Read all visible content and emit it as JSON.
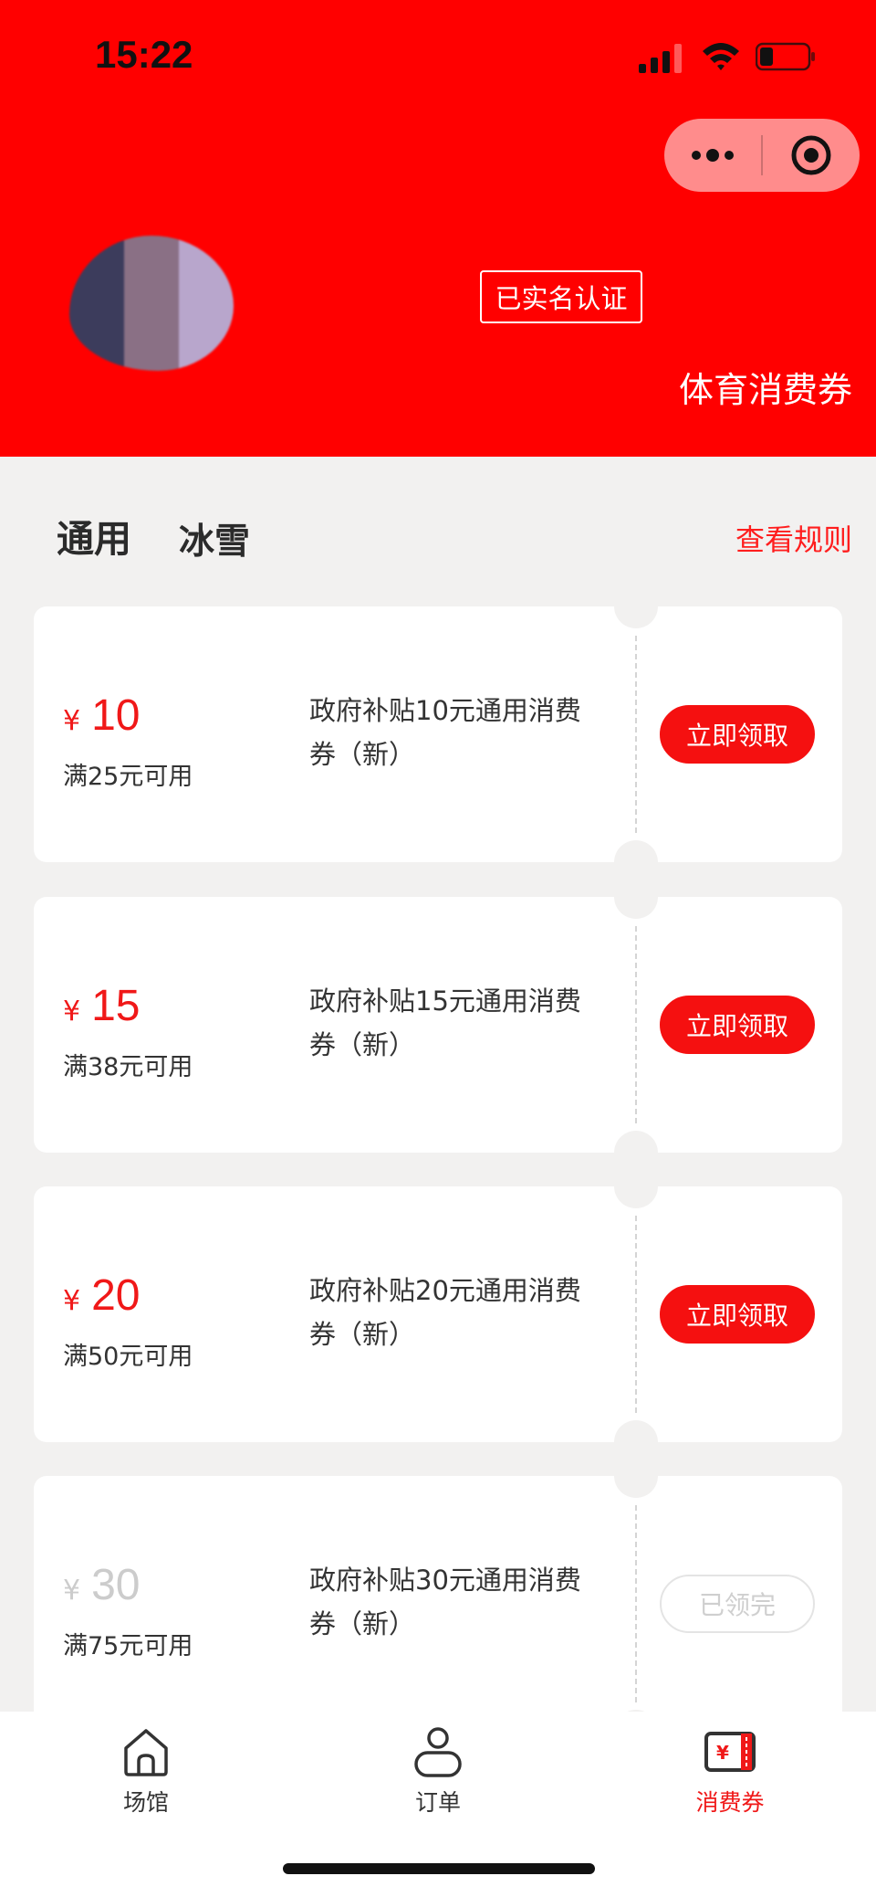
{
  "status_bar": {
    "time": "15:22"
  },
  "header": {
    "verified_label": "已实名认证",
    "title": "体育消费券",
    "brand_color": "#ff0000"
  },
  "tabs": [
    {
      "label": "通用",
      "active": true
    },
    {
      "label": "冰雪",
      "active": false
    }
  ],
  "rules_link": "查看规则",
  "coupons": [
    {
      "currency": "¥",
      "amount": "10",
      "threshold": "满25元可用",
      "desc": "政府补贴10元通用消费券（新）",
      "action": "立即领取",
      "available": true
    },
    {
      "currency": "¥",
      "amount": "15",
      "threshold": "满38元可用",
      "desc": "政府补贴15元通用消费券（新）",
      "action": "立即领取",
      "available": true
    },
    {
      "currency": "¥",
      "amount": "20",
      "threshold": "满50元可用",
      "desc": "政府补贴20元通用消费券（新）",
      "action": "立即领取",
      "available": true
    },
    {
      "currency": "¥",
      "amount": "30",
      "threshold": "满75元可用",
      "desc": "政府补贴30元通用消费券（新）",
      "action": "已领完",
      "available": false
    }
  ],
  "bottom_nav": [
    {
      "label": "场馆",
      "icon": "home-icon",
      "active": false
    },
    {
      "label": "订单",
      "icon": "user-icon",
      "active": false
    },
    {
      "label": "消费券",
      "icon": "coupon-icon",
      "active": true
    }
  ],
  "colors": {
    "accent": "#f01818",
    "disabled": "#cccccc"
  }
}
